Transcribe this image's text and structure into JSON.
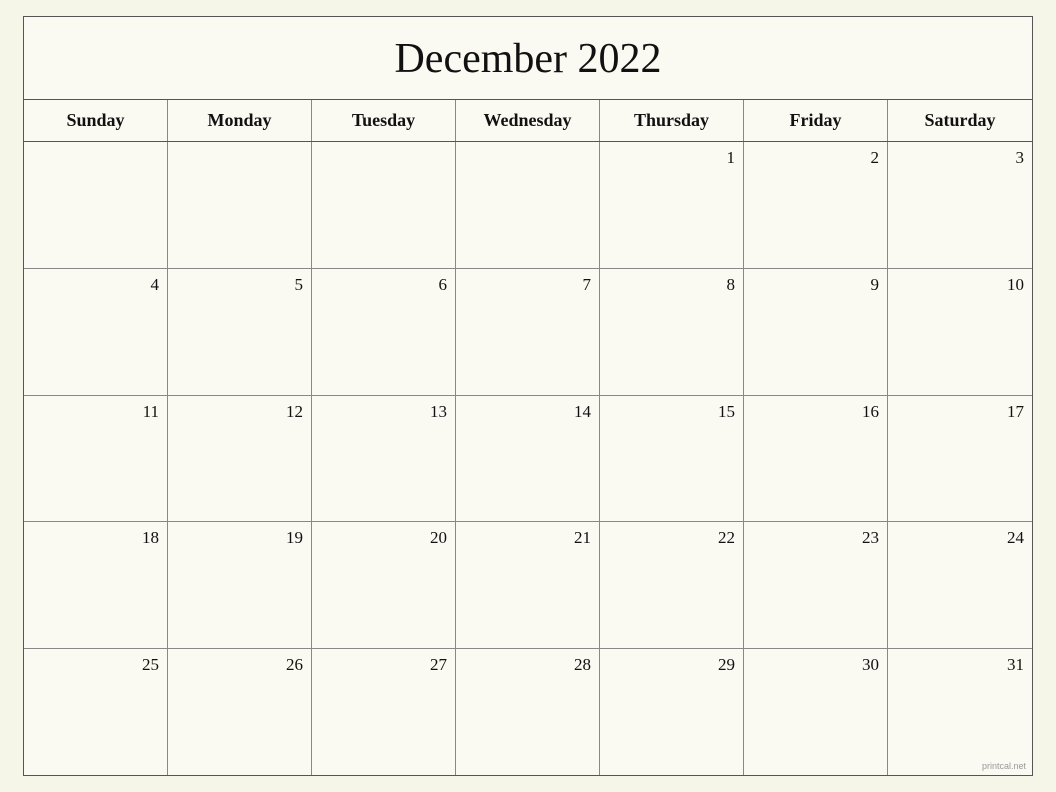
{
  "calendar": {
    "title": "December 2022",
    "days_of_week": [
      "Sunday",
      "Monday",
      "Tuesday",
      "Wednesday",
      "Thursday",
      "Friday",
      "Saturday"
    ],
    "weeks": [
      [
        null,
        null,
        null,
        null,
        1,
        2,
        3
      ],
      [
        4,
        5,
        6,
        7,
        8,
        9,
        10
      ],
      [
        11,
        12,
        13,
        14,
        15,
        16,
        17
      ],
      [
        18,
        19,
        20,
        21,
        22,
        23,
        24
      ],
      [
        25,
        26,
        27,
        28,
        29,
        30,
        31
      ]
    ],
    "watermark": "printcal.net"
  }
}
